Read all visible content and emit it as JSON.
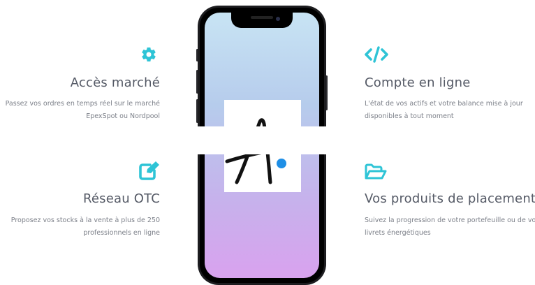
{
  "features": {
    "acces": {
      "icon": "gear-icon",
      "title": "Accès marché",
      "desc_line1": "Passez vos ordres en temps réel sur le marché",
      "desc_line2": "EpexSpot ou Nordpool"
    },
    "compte": {
      "icon": "code-icon",
      "title": "Compte en ligne",
      "desc_line1": "L'état de vos actifs et votre balance mise à jour",
      "desc_line2": "disponibles à tout moment"
    },
    "otc": {
      "icon": "edit-icon",
      "title": "Réseau OTC",
      "desc_line1": "Proposez vos stocks à la vente à plus de 250",
      "desc_line2": "professionnels en ligne"
    },
    "produits": {
      "icon": "folder-open-icon",
      "title": "Vos produits de placement",
      "desc_line1": "Suivez la progression de votre portefeuille ou de vos",
      "desc_line2": "livrets énergétiques"
    }
  },
  "colors": {
    "accent": "#2ec4d6",
    "title": "#555a66",
    "text": "#7b7f88",
    "logo_dot": "#1f8fe6"
  }
}
